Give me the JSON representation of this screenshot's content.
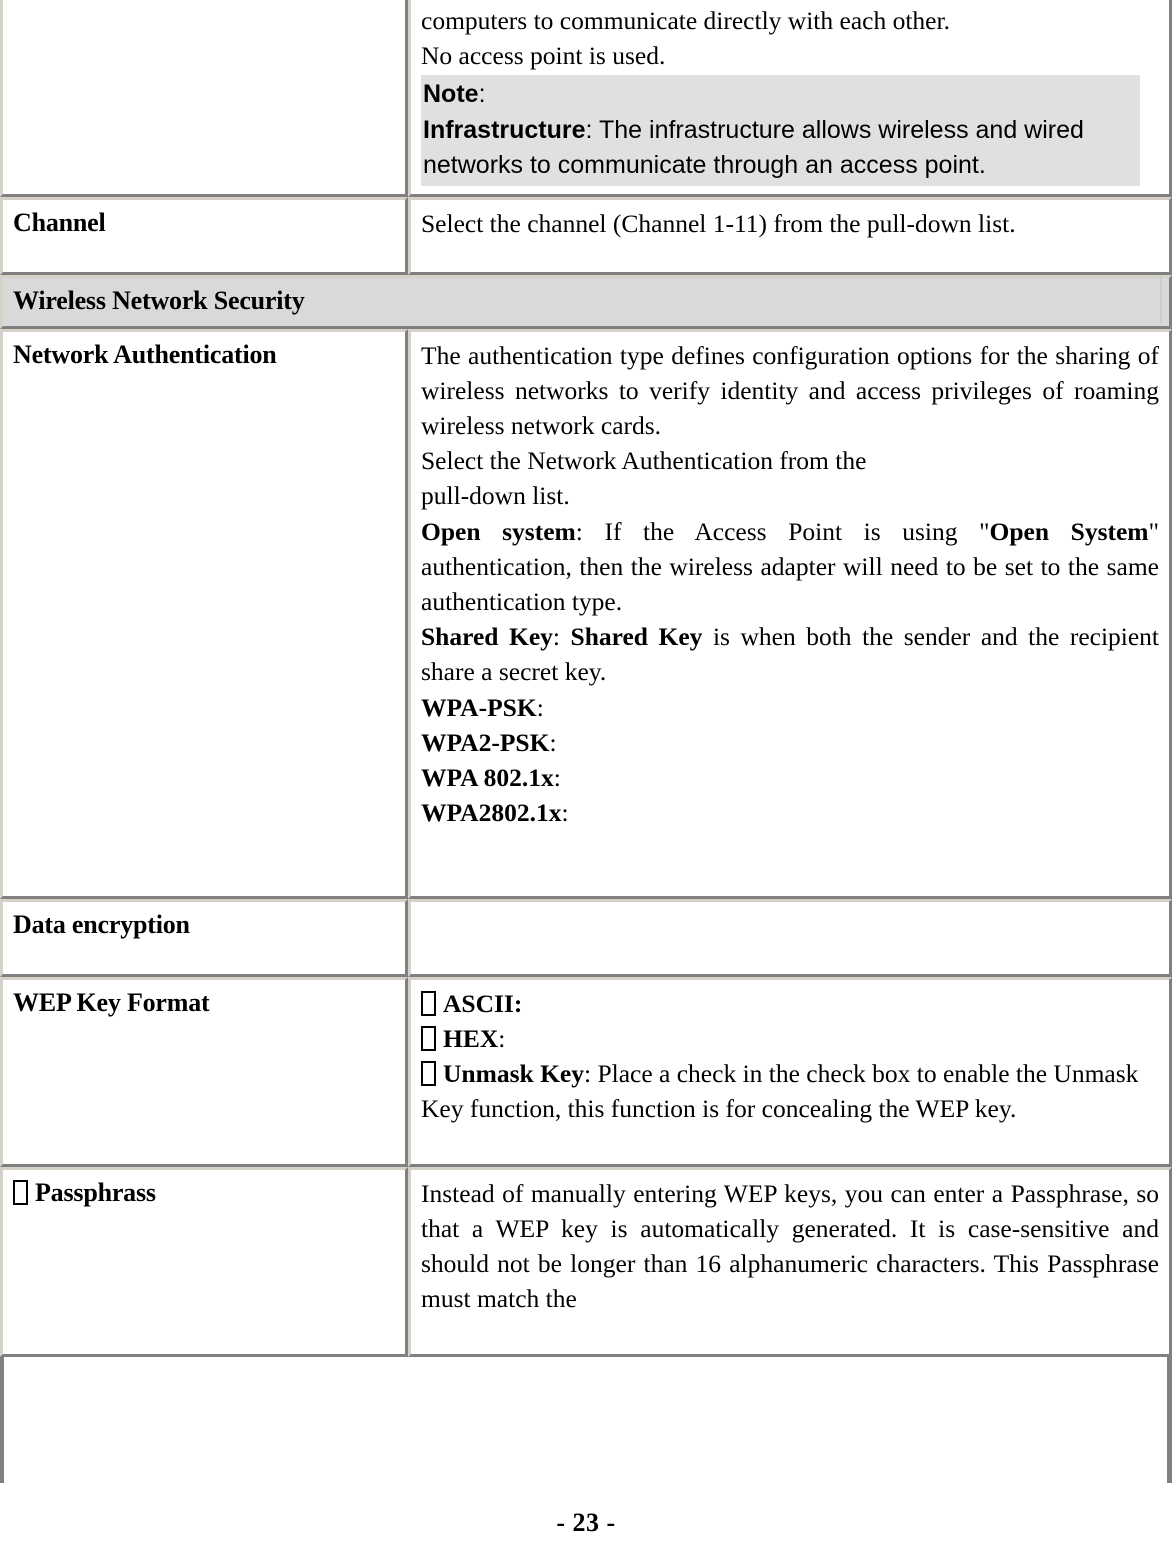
{
  "page": {
    "number_label": "- 23 -",
    "colors": {
      "border_light": "#d5d1c7",
      "border_dark": "#808080",
      "band_background": "#d9d9d9",
      "note_background": "#e0e0e0"
    }
  },
  "table": {
    "continued_row": {
      "label": "",
      "lines": [
        "computers to communicate directly with each other.",
        "No access point is used."
      ],
      "note": {
        "note_label": "Note",
        "note_colon": ":",
        "term": "Infrastructure",
        "term_colon": ": ",
        "text": "The infrastructure allows wireless and wired networks to communicate through an access point."
      }
    },
    "rows": [
      {
        "label": "Channel",
        "description": "Select the channel (Channel 1-11) from the pull-down list."
      },
      {
        "label": "Network Authentication",
        "paragraph_1": "The authentication type defines configuration options for the sharing of wireless networks to verify identity and access privileges of roaming wireless network cards.",
        "paragraph_2_line_1": "Select the Network Authentication from the",
        "paragraph_2_line_2": "pull-down list.",
        "items": [
          {
            "term": "Open system",
            "separator": ": ",
            "text_before": "If the Access Point is using \"",
            "emphasis": "Open System",
            "text_after": "\" authentication, then the wireless adapter will need to be set to the same authentication type."
          },
          {
            "term": "Shared Key",
            "separator": ": ",
            "emphasis": "Shared Key",
            "text_after": " is when both the sender and the recipient share a secret key."
          }
        ],
        "options": [
          {
            "term": "WPA-PSK",
            "colon": ":"
          },
          {
            "term": "WPA2-PSK",
            "colon": ":"
          },
          {
            "term": "WPA 802.1x",
            "colon": ":"
          },
          {
            "term": "WPA2802.1x",
            "colon": ":"
          }
        ]
      },
      {
        "label": "Data encryption",
        "description": ""
      },
      {
        "label": "WEP Key Format",
        "checkbox_items": [
          {
            "term": "ASCII:",
            "text": ""
          },
          {
            "term": "HEX",
            "colon": ":",
            "text": ""
          },
          {
            "term": "Unmask Key",
            "colon": ": ",
            "text": "Place a check in the check box to enable the Unmask Key function, this function is for concealing the WEP key."
          }
        ]
      },
      {
        "label": "Passphrass",
        "has_checkbox": true,
        "description": "Instead of manually entering WEP keys, you can enter a Passphrase, so that a WEP key is automatically generated. It is case-sensitive and should not be longer than 16 alphanumeric characters. This Passphrase must match the"
      }
    ],
    "section_band": {
      "title": "Wireless Network Security"
    }
  }
}
